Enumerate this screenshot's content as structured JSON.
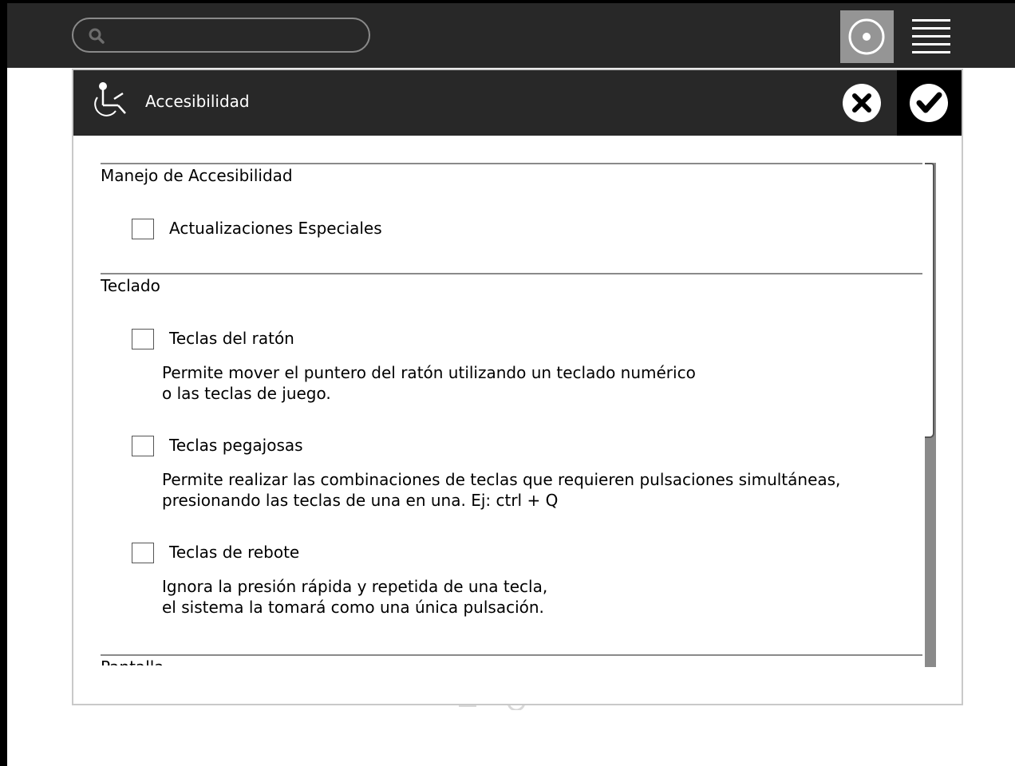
{
  "toolbar": {
    "search": {
      "placeholder": "",
      "value": "",
      "icon": "search-icon"
    },
    "frame_button_icon": "circle-dot-icon",
    "menu_button_icon": "hamburger-menu-icon"
  },
  "dialog": {
    "icon": "wheelchair-accessibility-icon",
    "title": "Accesibilidad",
    "cancel_icon": "close-circle-icon",
    "accept_icon": "check-circle-icon",
    "sections": [
      {
        "title": "Manejo de Accesibilidad",
        "options": [
          {
            "label": "Actualizaciones Especiales",
            "checked": false,
            "description": []
          }
        ]
      },
      {
        "title": "Teclado",
        "options": [
          {
            "label": "Teclas del ratón",
            "checked": false,
            "description": [
              "Permite mover el puntero del ratón utilizando un teclado numérico",
              "o las teclas de juego."
            ]
          },
          {
            "label": "Teclas pegajosas",
            "checked": false,
            "description": [
              "Permite realizar las combinaciones de teclas que requieren pulsaciones simultáneas,",
              "presionando las teclas de una en una. Ej: ctrl + Q"
            ]
          },
          {
            "label": "Teclas de rebote",
            "checked": false,
            "description": [
              "Ignora la presión rápida y repetida de una tecla,",
              "el sistema la tomará como una única pulsación."
            ]
          }
        ]
      },
      {
        "title": "Pantalla",
        "options": []
      }
    ],
    "scroll_position": 0.0
  },
  "colors": {
    "toolbar_bg": "#282828",
    "header_bg": "#282828",
    "accept_bg": "#000000",
    "active_button_bg": "#959595",
    "rule": "#8a8a8a"
  }
}
